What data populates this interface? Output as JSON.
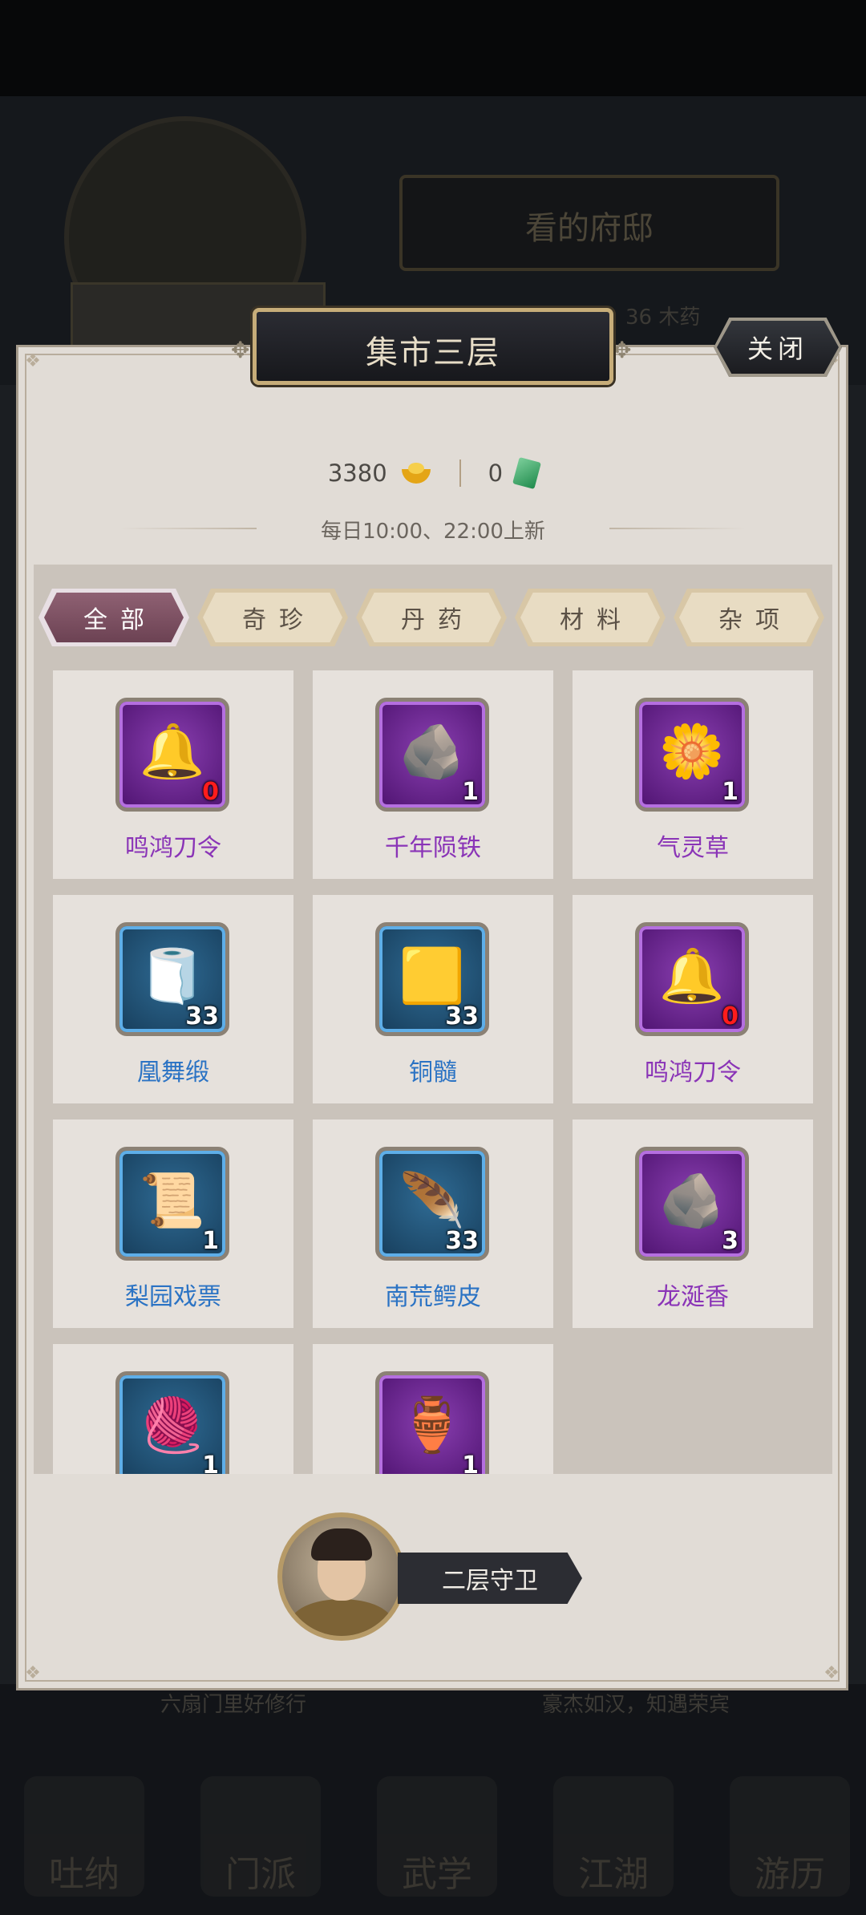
{
  "background": {
    "title": "看的府邸",
    "info": "36 木药",
    "footer_left": "六扇门里好修行",
    "footer_right": "豪杰如汉，知遇荣宾",
    "nav": [
      "吐纳",
      "门派",
      "武学",
      "江湖",
      "游历"
    ]
  },
  "header": {
    "title": "集市三层",
    "close_label": "关闭"
  },
  "currency": {
    "gold": "3380",
    "jade": "0"
  },
  "refresh_text": "每日10:00、22:00上新",
  "tabs": [
    {
      "label": "全部",
      "active": true
    },
    {
      "label": "奇珍",
      "active": false
    },
    {
      "label": "丹药",
      "active": false
    },
    {
      "label": "材料",
      "active": false
    },
    {
      "label": "杂项",
      "active": false
    }
  ],
  "items": [
    {
      "name": "鸣鸿刀令",
      "count": "0",
      "quality": "purple",
      "icon": "bell-token-icon"
    },
    {
      "name": "千年陨铁",
      "count": "1",
      "quality": "purple",
      "icon": "meteor-iron-icon"
    },
    {
      "name": "气灵草",
      "count": "1",
      "quality": "purple",
      "icon": "herb-flower-icon"
    },
    {
      "name": "凰舞缎",
      "count": "33",
      "quality": "blue",
      "icon": "silk-roll-icon"
    },
    {
      "name": "铜髓",
      "count": "33",
      "quality": "blue",
      "icon": "copper-ore-icon"
    },
    {
      "name": "鸣鸿刀令",
      "count": "0",
      "quality": "purple",
      "icon": "bell-token-icon"
    },
    {
      "name": "梨园戏票",
      "count": "1",
      "quality": "blue",
      "icon": "ticket-icon"
    },
    {
      "name": "南荒鳄皮",
      "count": "33",
      "quality": "blue",
      "icon": "hide-icon"
    },
    {
      "name": "龙涎香",
      "count": "3",
      "quality": "purple",
      "icon": "ambergris-icon"
    },
    {
      "name": "",
      "count": "1",
      "quality": "blue",
      "icon": "yarn-ball-icon"
    },
    {
      "name": "",
      "count": "1",
      "quality": "purple",
      "icon": "seal-jar-icon"
    }
  ],
  "guard": {
    "label": "二层守卫"
  }
}
